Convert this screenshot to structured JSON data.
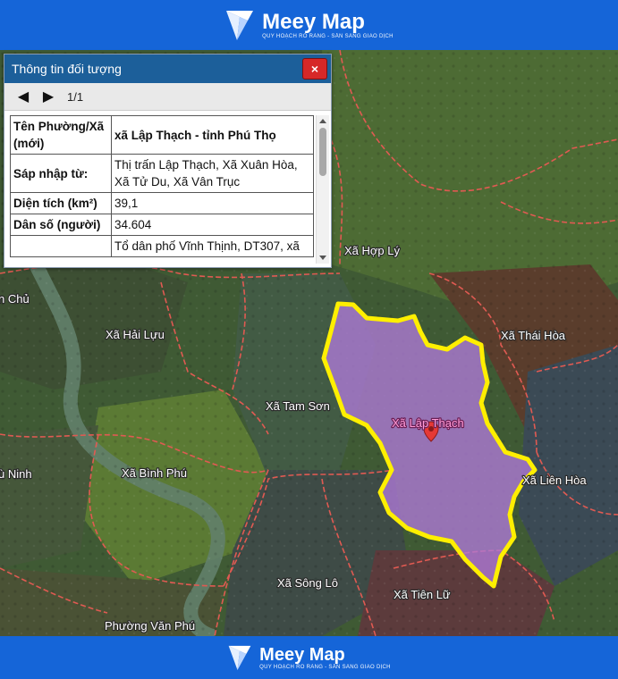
{
  "brand": {
    "name": "Meey Map",
    "tagline": "QUY HOẠCH RÕ RÀNG - SẴN SÀNG GIAO DỊCH"
  },
  "panel": {
    "title": "Thông tin đối tượng",
    "close_label": "×",
    "page_indicator": "1/1",
    "rows": [
      {
        "key": "Tên Phường/Xã (mới)",
        "value": "xã Lập Thạch - tỉnh Phú Thọ"
      },
      {
        "key": "Sáp nhập từ:",
        "value": "Thị trấn Lập Thạch, Xã Xuân Hòa, Xã Tử Du, Xã Vân Trục"
      },
      {
        "key": "Diện tích (km²)",
        "value": "39,1"
      },
      {
        "key": "Dân số (người)",
        "value": "34.604"
      },
      {
        "key": "",
        "value": "Tổ dân phố Vĩnh Thịnh, DT307, xã"
      }
    ]
  },
  "map": {
    "labels": {
      "hop_ly": "Xã Hợp Lý",
      "hai_luu": "Xã Hải Lựu",
      "thai_hoa": "Xã Thái Hòa",
      "tam_son": "Xã Tam Sơn",
      "lap_thach": "Xã Lập Thạch",
      "lien_hoa": "Xã Liên Hòa",
      "binh_phu": "Xã Bình Phú",
      "song_lo": "Xã Sông Lô",
      "tien_lu": "Xã Tiên Lữ",
      "van_phu": "Phường Văn Phú",
      "chu": "n Chủ",
      "ninh": "ù Ninh"
    },
    "colors": {
      "selected_fill": "#b07ad8",
      "selected_outline": "#ffef00",
      "boundary": "#e05a52",
      "brand_blue": "#1565d8"
    }
  }
}
